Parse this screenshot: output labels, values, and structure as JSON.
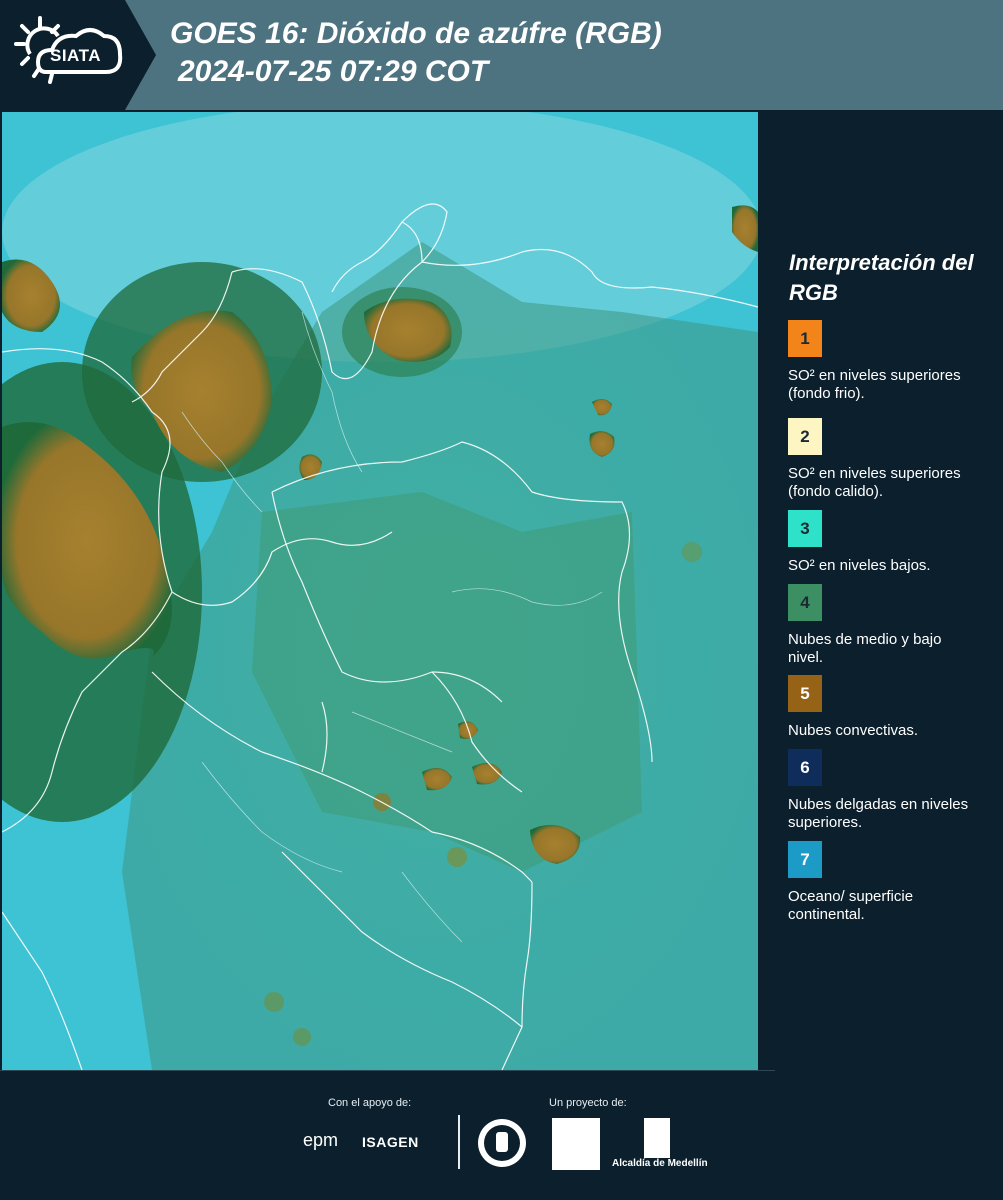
{
  "header": {
    "logo_text": "SIATA",
    "title": "GOES 16: Dióxido de azúfre (RGB)",
    "subtitle": "2024-07-25 07:29 COT"
  },
  "legend": {
    "title": "Interpretación del RGB",
    "items": [
      {
        "number": "1",
        "text": "SO² en niveles superiores (fondo frio).",
        "color": "#f28419"
      },
      {
        "number": "2",
        "text": "SO² en niveles superiores (fondo calido).",
        "color": "#fdf6c3"
      },
      {
        "number": "3",
        "text": "SO² en niveles bajos.",
        "color": "#2de2c8"
      },
      {
        "number": "4",
        "text": "Nubes de medio y bajo nivel.",
        "color": "#3b8f63"
      },
      {
        "number": "5",
        "text": "Nubes convectivas.",
        "color": "#966316"
      },
      {
        "number": "6",
        "text": "Nubes delgadas en niveles superiores.",
        "color": "#0e2d5a"
      },
      {
        "number": "7",
        "text": "Oceano/ superficie continental.",
        "color": "#1c9bc6"
      }
    ]
  },
  "footer": {
    "support_label": "Con el apoyo de:",
    "project_label": "Un proyecto de:",
    "sponsor_1": "epm",
    "sponsor_2": "ISAGEN",
    "partner_label": "Alcaldía de Medellín"
  },
  "map": {
    "ocean_color": "#3ec3d4",
    "land_color": "#3f9a7a",
    "convective_color": "#a17a2d",
    "border_color": "#ffffff"
  }
}
